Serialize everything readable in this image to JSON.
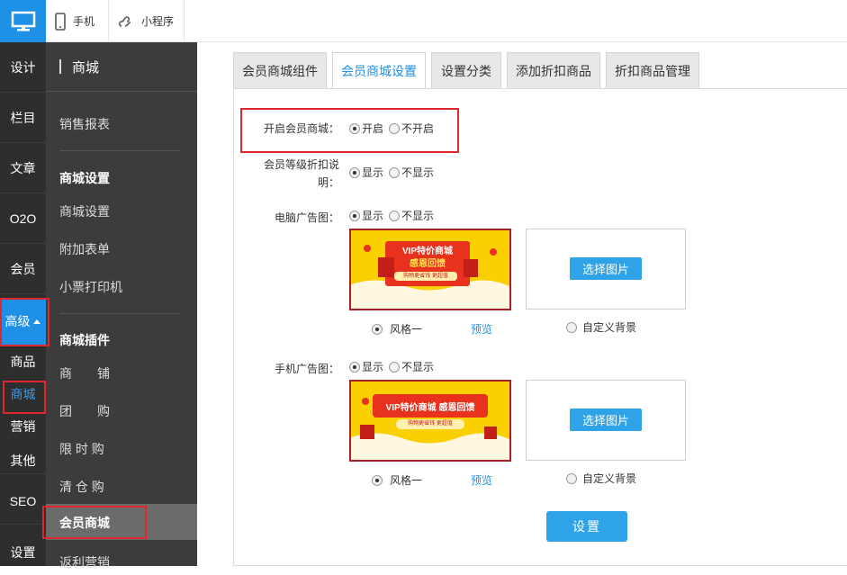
{
  "topbar": {
    "tabs": [
      {
        "label": "手机",
        "icon": "mobile-icon"
      },
      {
        "label": "小程序",
        "icon": "mini-program-icon"
      }
    ]
  },
  "leftnav": {
    "items": [
      "设计",
      "栏目",
      "文章",
      "O2O",
      "会员"
    ],
    "advanced": "高级",
    "subitems": [
      "商品",
      "商城",
      "营销",
      "其他"
    ],
    "bottom": [
      "SEO",
      "设置"
    ]
  },
  "sidebar": {
    "header": "商城",
    "report": "销售报表",
    "group1_title": "商城设置",
    "group1_items": [
      "商城设置",
      "附加表单",
      "小票打印机"
    ],
    "group2_title": "商城插件",
    "group2_items": [
      "商　　铺",
      "团　　购",
      "限 时 购",
      "清 仓 购",
      "会员商城",
      "返利营销"
    ]
  },
  "tabs": [
    "会员商城组件",
    "会员商城设置",
    "设置分类",
    "添加折扣商品",
    "折扣商品管理"
  ],
  "form": {
    "enable_label": "开启会员商城：",
    "enable_on": "开启",
    "enable_off": "不开启",
    "discount_label_1": "会员等级折扣说",
    "discount_label_2": "明：",
    "show": "显示",
    "hide": "不显示",
    "pc_label": "电脑广告图：",
    "mobile_label": "手机广告图：",
    "style_one": "风格一",
    "preview": "预览",
    "custom_bg": "自定义背景",
    "pick_image": "选择图片",
    "submit": "设置"
  },
  "banner": {
    "pc_title": "VIP特价商城",
    "pc_sub": "感恩回馈",
    "pc_tag": "购物更省钱 更超值",
    "mobile_title": "VIP特价商城 感恩回馈",
    "mobile_tag": "购物更省钱 更超值"
  },
  "colors": {
    "accent": "#2fa3e8",
    "highlight": "#e0262f",
    "nav": "#2e2e2e",
    "sidebar": "#3c3c3c"
  }
}
